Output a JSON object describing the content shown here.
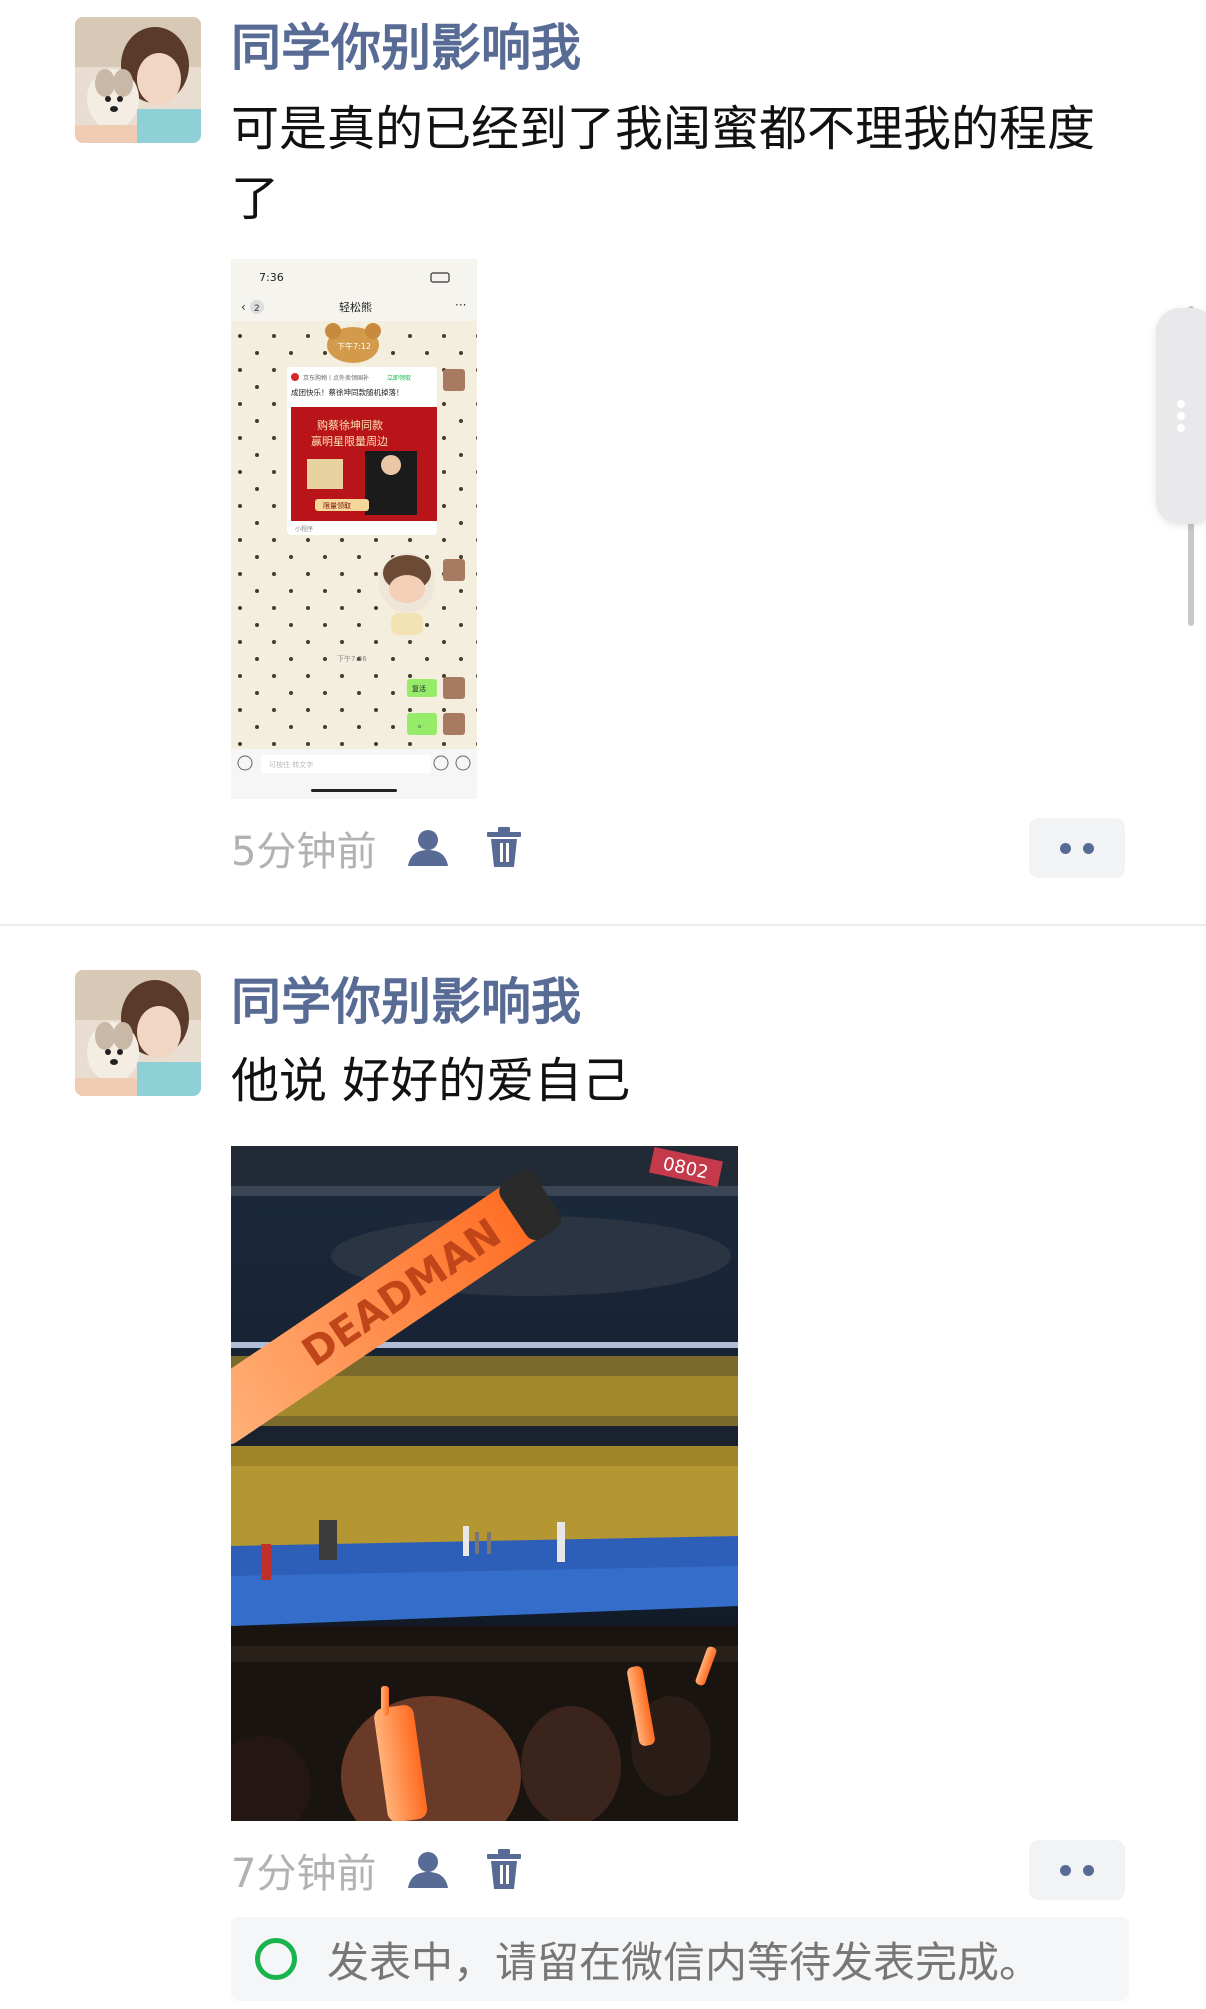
{
  "posts": [
    {
      "nickname": "同学你别影响我",
      "text": "可是真的已经到了我闺蜜都不理我的程度了",
      "time": "5分钟前",
      "image": {
        "kind": "phone-chat-screenshot",
        "status_time": "7:36",
        "chat_title": "轻松熊",
        "back_count": "2",
        "timestamp_1": "下午7:12",
        "card_header": "京东购物丨点外卖领国补",
        "card_header_tag": "立即领取",
        "card_title": "成团快乐！蔡徐坤同款随机掉落！",
        "card_line_1": "购蔡徐坤同款",
        "card_line_2": "赢明星限量周边",
        "card_button": "限量领取",
        "card_footer": "小程序",
        "timestamp_2": "下午7:36",
        "bubble_1": "复活",
        "bubble_2": "。",
        "input_placeholder": "可按住 转文字"
      }
    },
    {
      "nickname": "同学你别影响我",
      "text": "他说 好好的爱自己",
      "time": "7分钟前",
      "image": {
        "kind": "concert-photo",
        "lightstick_text": "DEADMAN",
        "banner_text": "0802"
      }
    }
  ],
  "status": {
    "text": "发表中，请留在微信内等待发表完成。"
  },
  "icons": {
    "visibility": "person-icon",
    "delete": "trash-icon",
    "more": "more-dots-icon",
    "status": "status-circle-icon"
  },
  "colors": {
    "nickname": "#576b95",
    "time": "#b2b2b2",
    "status_ring": "#19b44e"
  }
}
